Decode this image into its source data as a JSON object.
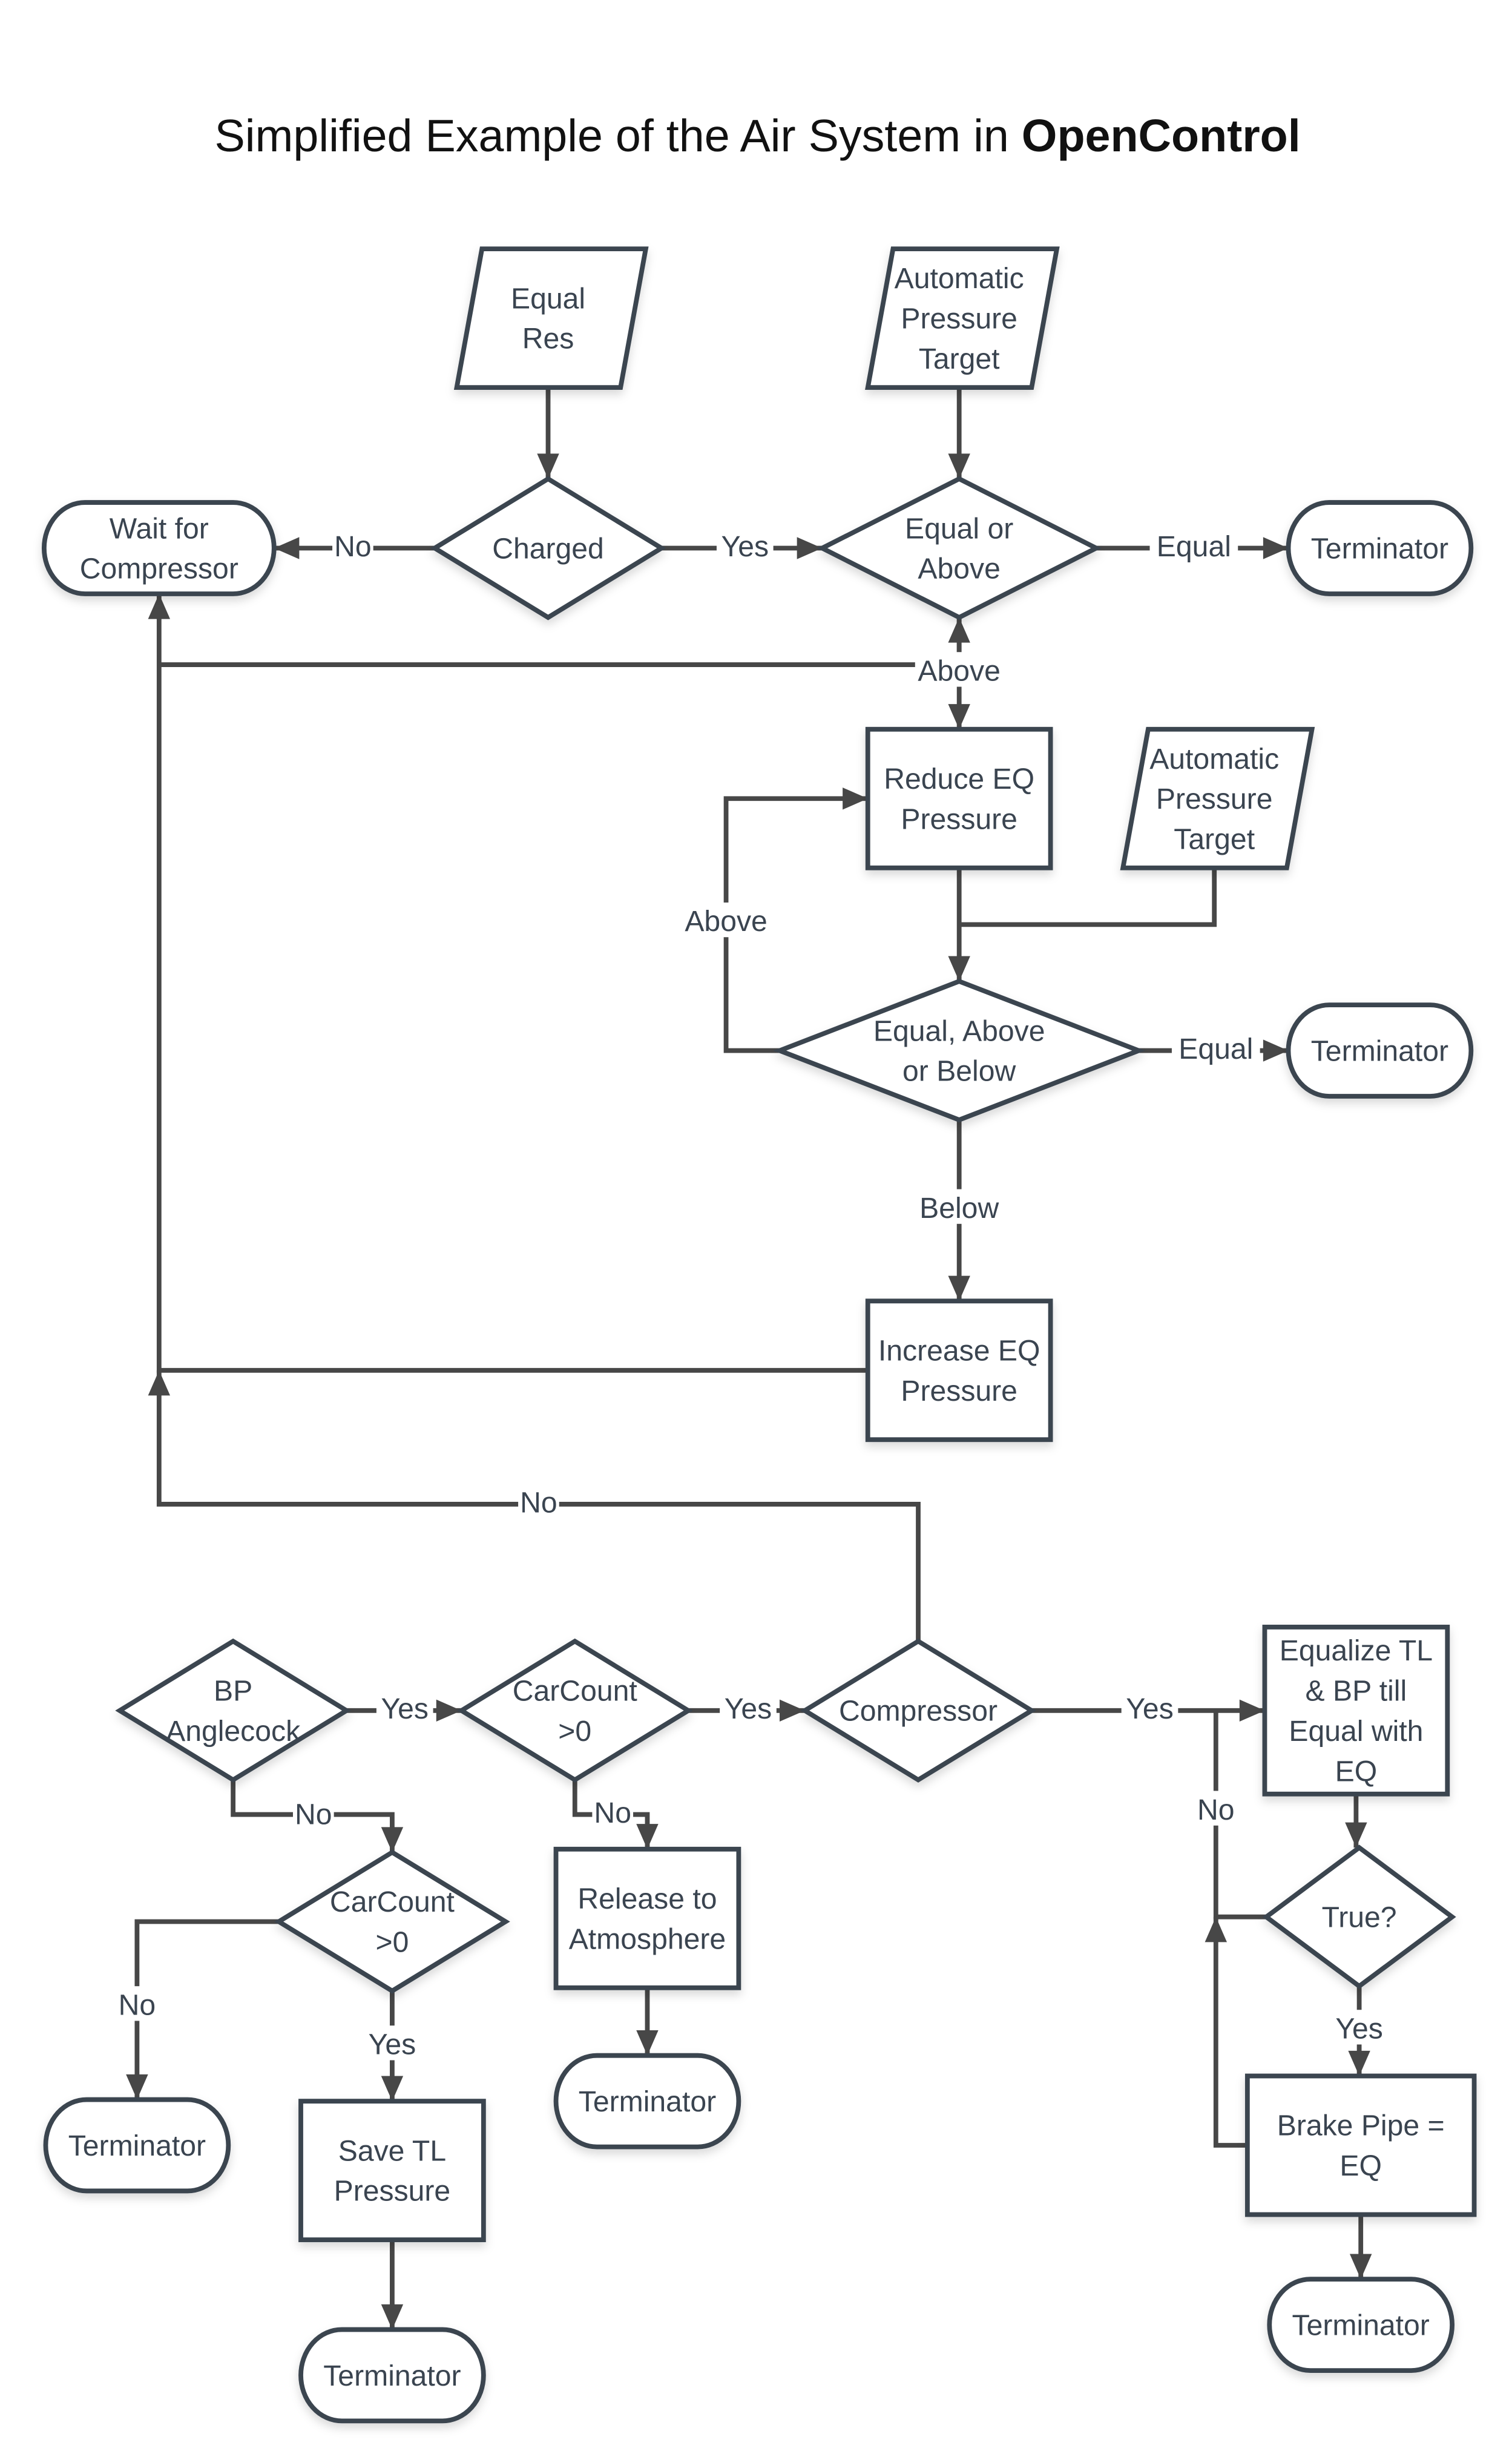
{
  "title": {
    "prefix": "Simplified Example of the Air System in ",
    "emphasis": "OpenControl"
  },
  "colors": {
    "shape_stroke": "#3a4450",
    "connector": "#474747",
    "text": "#3a4450",
    "title_text": "#111111",
    "background": "#ffffff"
  },
  "nodes": [
    {
      "id": "equal-res",
      "type": "input",
      "lines": [
        "Equal",
        "Res"
      ]
    },
    {
      "id": "auto-pressure-target-1",
      "type": "input",
      "lines": [
        "Automatic",
        "Pressure",
        "Target"
      ]
    },
    {
      "id": "wait-for-compressor",
      "type": "terminator",
      "lines": [
        "Wait for",
        "Compressor"
      ]
    },
    {
      "id": "charged",
      "type": "decision",
      "lines": [
        "Charged"
      ]
    },
    {
      "id": "equal-or-above",
      "type": "decision",
      "lines": [
        "Equal or",
        "Above"
      ]
    },
    {
      "id": "terminator-1",
      "type": "terminator",
      "lines": [
        "Terminator"
      ]
    },
    {
      "id": "reduce-eq-pressure",
      "type": "process",
      "lines": [
        "Reduce EQ",
        "Pressure"
      ]
    },
    {
      "id": "auto-pressure-target-2",
      "type": "input",
      "lines": [
        "Automatic",
        "Pressure",
        "Target"
      ]
    },
    {
      "id": "equal-above-below",
      "type": "decision",
      "lines": [
        "Equal, Above",
        "or Below"
      ]
    },
    {
      "id": "terminator-2",
      "type": "terminator",
      "lines": [
        "Terminator"
      ]
    },
    {
      "id": "increase-eq-pressure",
      "type": "process",
      "lines": [
        "Increase EQ",
        "Pressure"
      ]
    },
    {
      "id": "bp-anglecock",
      "type": "decision",
      "lines": [
        "BP",
        "Anglecock"
      ]
    },
    {
      "id": "carcount-1",
      "type": "decision",
      "lines": [
        "CarCount",
        ">0"
      ]
    },
    {
      "id": "compressor",
      "type": "decision",
      "lines": [
        "Compressor"
      ]
    },
    {
      "id": "equalize-tl-bp",
      "type": "process",
      "lines": [
        "Equalize TL",
        "& BP till",
        "Equal with",
        "EQ"
      ]
    },
    {
      "id": "carcount-2",
      "type": "decision",
      "lines": [
        "CarCount",
        ">0"
      ]
    },
    {
      "id": "release-to-atmosphere",
      "type": "process",
      "lines": [
        "Release to",
        "Atmosphere"
      ]
    },
    {
      "id": "true-check",
      "type": "decision",
      "lines": [
        "True?"
      ]
    },
    {
      "id": "terminator-3",
      "type": "terminator",
      "lines": [
        "Terminator"
      ]
    },
    {
      "id": "save-tl-pressure",
      "type": "process",
      "lines": [
        "Save TL",
        "Pressure"
      ]
    },
    {
      "id": "terminator-4",
      "type": "terminator",
      "lines": [
        "Terminator"
      ]
    },
    {
      "id": "brake-pipe-eq",
      "type": "process",
      "lines": [
        "Brake Pipe =",
        "EQ"
      ]
    },
    {
      "id": "terminator-5",
      "type": "terminator",
      "lines": [
        "Terminator"
      ]
    },
    {
      "id": "terminator-6",
      "type": "terminator",
      "lines": [
        "Terminator"
      ]
    }
  ],
  "edges": [
    {
      "from": "equal-res",
      "to": "charged",
      "label": ""
    },
    {
      "from": "auto-pressure-target-1",
      "to": "equal-or-above",
      "label": ""
    },
    {
      "from": "charged",
      "to": "wait-for-compressor",
      "label": "No"
    },
    {
      "from": "charged",
      "to": "equal-or-above",
      "label": "Yes"
    },
    {
      "from": "equal-or-above",
      "to": "terminator-1",
      "label": "Equal"
    },
    {
      "from": "equal-or-above",
      "to": "reduce-eq-pressure",
      "label": "Above"
    },
    {
      "from": "reduce-eq-pressure",
      "to": "equal-above-below",
      "label": ""
    },
    {
      "from": "auto-pressure-target-2",
      "to": "equal-above-below",
      "label": ""
    },
    {
      "from": "equal-above-below",
      "to": "reduce-eq-pressure",
      "label": "Above"
    },
    {
      "from": "equal-above-below",
      "to": "terminator-2",
      "label": "Equal"
    },
    {
      "from": "equal-above-below",
      "to": "increase-eq-pressure",
      "label": "Below"
    },
    {
      "from": "increase-eq-pressure",
      "to": "wait-for-compressor",
      "label": ""
    },
    {
      "from": "compressor",
      "to": "wait-for-compressor",
      "label": "No"
    },
    {
      "from": "bp-anglecock",
      "to": "carcount-1",
      "label": "Yes"
    },
    {
      "from": "bp-anglecock",
      "to": "carcount-2",
      "label": "No"
    },
    {
      "from": "carcount-1",
      "to": "compressor",
      "label": "Yes"
    },
    {
      "from": "carcount-1",
      "to": "release-to-atmosphere",
      "label": "No"
    },
    {
      "from": "compressor",
      "to": "equalize-tl-bp",
      "label": "Yes"
    },
    {
      "from": "equalize-tl-bp",
      "to": "true-check",
      "label": ""
    },
    {
      "from": "true-check",
      "to": "equalize-tl-bp",
      "label": "No"
    },
    {
      "from": "true-check",
      "to": "brake-pipe-eq",
      "label": "Yes"
    },
    {
      "from": "brake-pipe-eq",
      "to": "equalize-tl-bp",
      "label": ""
    },
    {
      "from": "carcount-2",
      "to": "terminator-3",
      "label": "No"
    },
    {
      "from": "carcount-2",
      "to": "save-tl-pressure",
      "label": "Yes"
    },
    {
      "from": "release-to-atmosphere",
      "to": "terminator-4",
      "label": ""
    },
    {
      "from": "save-tl-pressure",
      "to": "terminator-6",
      "label": ""
    },
    {
      "from": "brake-pipe-eq",
      "to": "terminator-5",
      "label": ""
    }
  ]
}
